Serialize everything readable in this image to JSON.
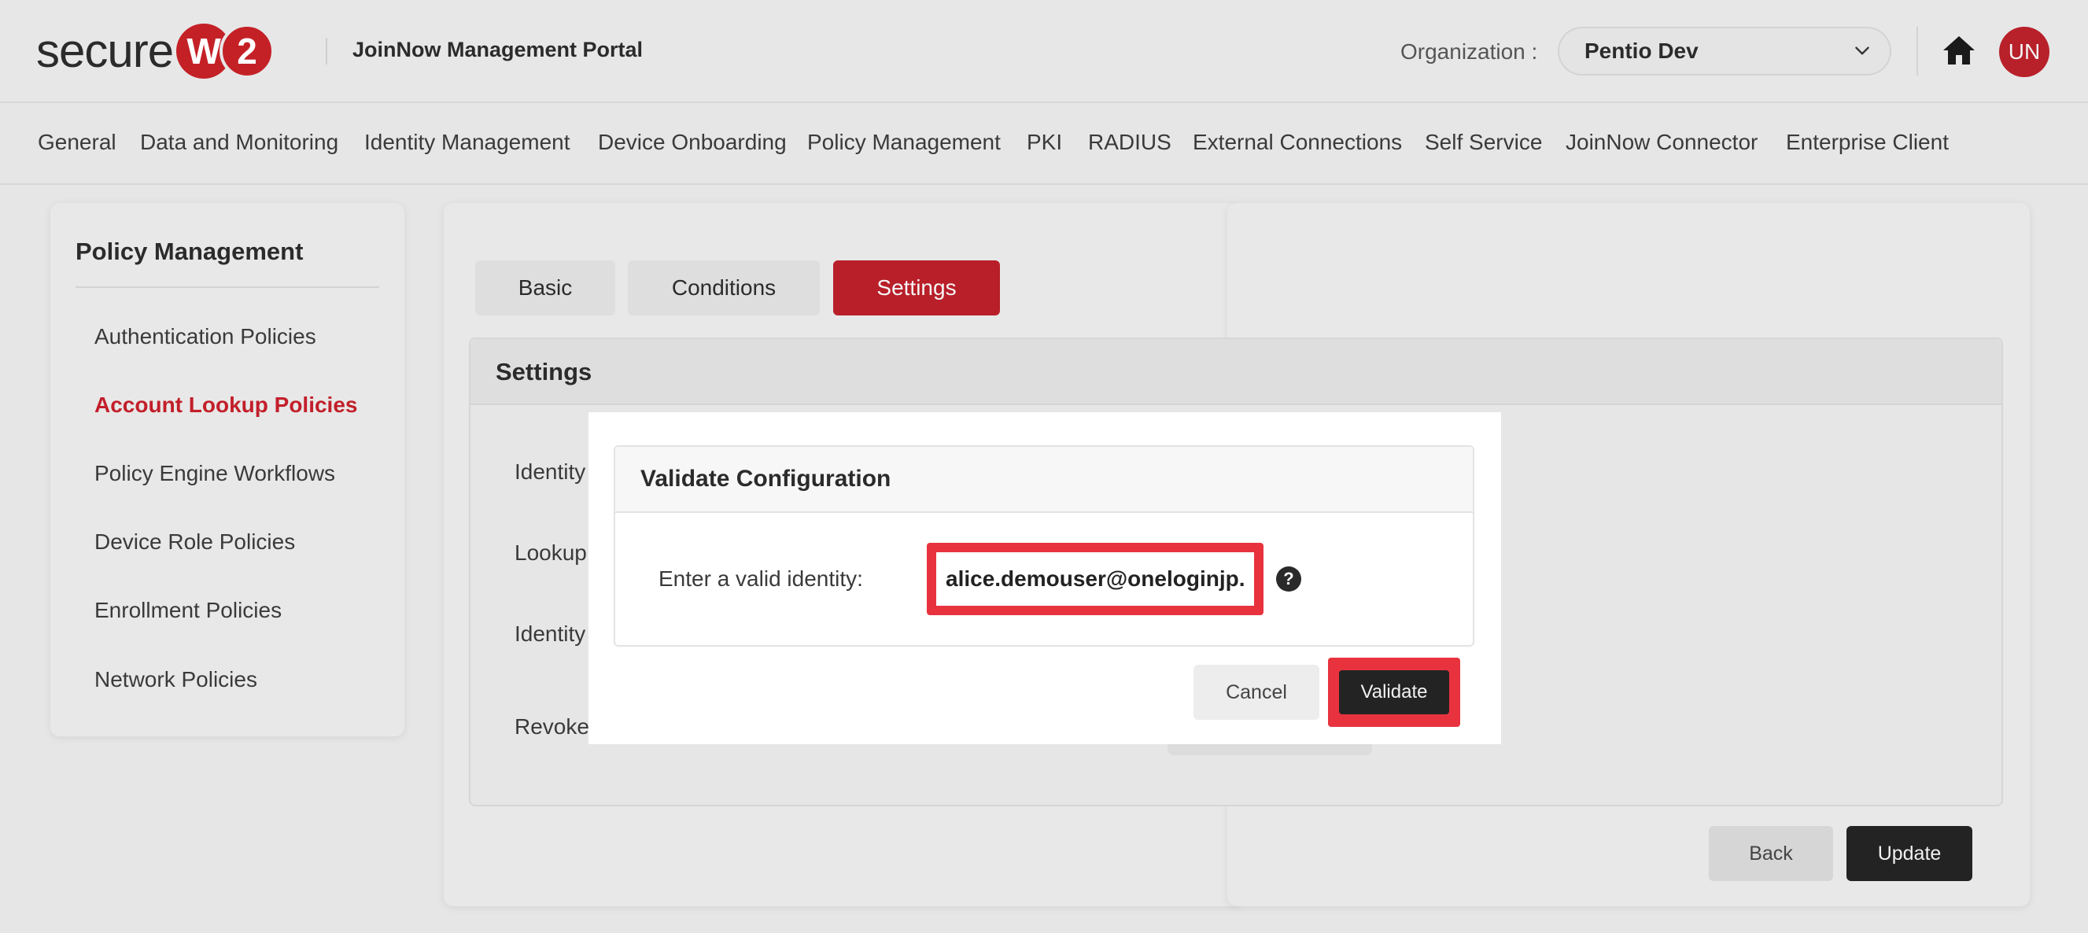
{
  "brand": {
    "logo_text": "secure",
    "logo_badge_1": "W",
    "logo_badge_2": "2",
    "accent_color": "#b81f29"
  },
  "header": {
    "portal_title": "JoinNow Management Portal",
    "org_label": "Organization :",
    "org_value": "Pentio Dev",
    "avatar_initials": "UN",
    "icons": [
      "chevron-down-icon",
      "home-icon"
    ]
  },
  "nav": {
    "items": [
      "General",
      "Data and Monitoring",
      "Identity Management",
      "Device Onboarding",
      "Policy Management",
      "PKI",
      "RADIUS",
      "External Connections",
      "Self Service",
      "JoinNow Connector",
      "Enterprise Client"
    ]
  },
  "sidebar": {
    "title": "Policy Management",
    "items": [
      "Authentication Policies",
      "Account Lookup Policies",
      "Policy Engine Workflows",
      "Device Role Policies",
      "Enrollment Policies",
      "Network Policies"
    ],
    "active_index": 1
  },
  "tabs": {
    "items": [
      "Basic",
      "Conditions",
      "Settings"
    ],
    "active_index": 2
  },
  "settings": {
    "title": "Settings",
    "field_labels": [
      "Identity",
      "Lookup",
      "Identity",
      "Revoke"
    ]
  },
  "modal": {
    "title": "Validate Configuration",
    "identity_label": "Enter a valid identity:",
    "identity_value": "alice.demouser@oneloginjp.onmicrosoft.com",
    "help_icon": "?",
    "cancel_label": "Cancel",
    "validate_label": "Validate",
    "highlight_color": "#e8333f"
  },
  "footer_buttons": {
    "back_label": "Back",
    "update_label": "Update"
  }
}
